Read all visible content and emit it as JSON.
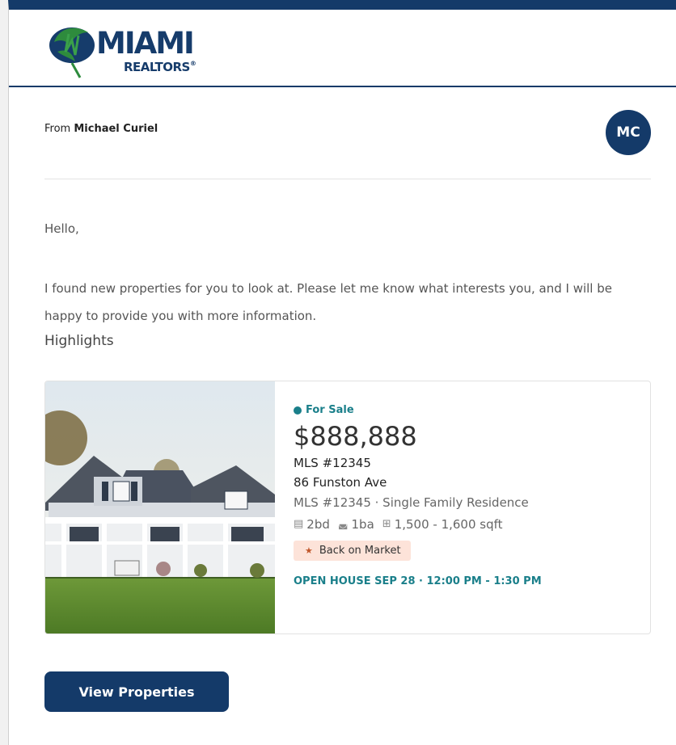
{
  "brand": {
    "name": "MIAMI",
    "sub": "REALTORS",
    "mark": "®"
  },
  "sender": {
    "prefix": "From",
    "name": "Michael Curiel",
    "initials": "MC"
  },
  "message": {
    "greeting": "Hello,",
    "intro": "I found new properties for you to look at. Please let me know what interests you, and I will be happy to provide you with more information.",
    "highlights_heading": "Highlights"
  },
  "listing": {
    "status": "For Sale",
    "price": "$888,888",
    "mls": "MLS #12345",
    "address": "86 Funston Ave",
    "meta": "MLS #12345 · Single Family Residence",
    "beds": "2bd",
    "baths": "1ba",
    "area": "1,500 - 1,600 sqft",
    "badge": "Back on Market",
    "open_house": "OPEN HOUSE SEP 28 · 12:00 PM - 1:30 PM",
    "icons": {
      "bed": "bed-icon",
      "bath": "bath-icon",
      "area": "floorplan-icon",
      "badge": "star-icon"
    }
  },
  "cta": {
    "label": "View Properties"
  },
  "colors": {
    "navy": "#143a69",
    "teal": "#1a7f8a",
    "green": "#2e8b3d",
    "badge_bg": "#fde3d9"
  }
}
